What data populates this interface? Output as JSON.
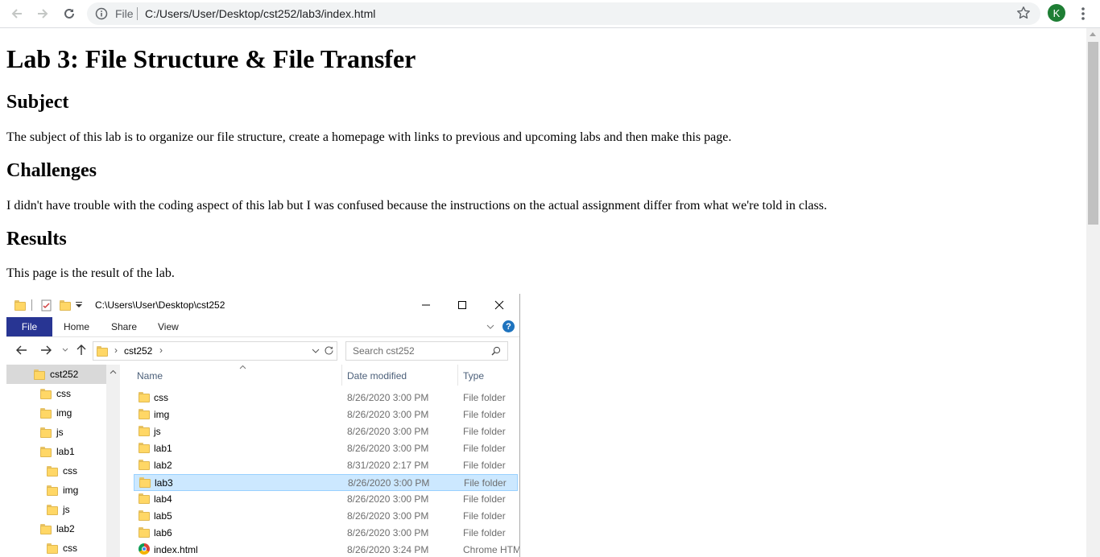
{
  "browser": {
    "scheme_label": "File",
    "url": "C:/Users/User/Desktop/cst252/lab3/index.html",
    "avatar_letter": "K",
    "avatar_color": "#1e7e34"
  },
  "page": {
    "title": "Lab 3: File Structure & File Transfer",
    "sections": [
      {
        "heading": "Subject",
        "text": "The subject of this lab is to organize our file structure, create a homepage with links to previous and upcoming labs and then make this page."
      },
      {
        "heading": "Challenges",
        "text": "I didn't have trouble with the coding aspect of this lab but I was confused because the instructions on the actual assignment differ from what we're told in class."
      },
      {
        "heading": "Results",
        "text": "This page is the result of the lab."
      }
    ]
  },
  "explorer": {
    "title_path": "C:\\Users\\User\\Desktop\\cst252",
    "ribbon": {
      "file": "File",
      "home": "Home",
      "share": "Share",
      "view": "View"
    },
    "address_crumb": "cst252",
    "search_placeholder": "Search cst252",
    "nav_tree": [
      {
        "label": "cst252",
        "level": 0,
        "selected": true
      },
      {
        "label": "css",
        "level": 1
      },
      {
        "label": "img",
        "level": 1
      },
      {
        "label": "js",
        "level": 1
      },
      {
        "label": "lab1",
        "level": 1
      },
      {
        "label": "css",
        "level": 2
      },
      {
        "label": "img",
        "level": 2
      },
      {
        "label": "js",
        "level": 2
      },
      {
        "label": "lab2",
        "level": 1
      },
      {
        "label": "css",
        "level": 2
      }
    ],
    "columns": {
      "name": "Name",
      "date": "Date modified",
      "type": "Type"
    },
    "files": [
      {
        "name": "css",
        "date": "8/26/2020 3:00 PM",
        "type": "File folder",
        "icon": "folder-icon"
      },
      {
        "name": "img",
        "date": "8/26/2020 3:00 PM",
        "type": "File folder",
        "icon": "folder-icon"
      },
      {
        "name": "js",
        "date": "8/26/2020 3:00 PM",
        "type": "File folder",
        "icon": "folder-icon"
      },
      {
        "name": "lab1",
        "date": "8/26/2020 3:00 PM",
        "type": "File folder",
        "icon": "folder-icon"
      },
      {
        "name": "lab2",
        "date": "8/31/2020 2:17 PM",
        "type": "File folder",
        "icon": "folder-icon"
      },
      {
        "name": "lab3",
        "date": "8/26/2020 3:00 PM",
        "type": "File folder",
        "icon": "folder-icon",
        "selected": true
      },
      {
        "name": "lab4",
        "date": "8/26/2020 3:00 PM",
        "type": "File folder",
        "icon": "folder-icon"
      },
      {
        "name": "lab5",
        "date": "8/26/2020 3:00 PM",
        "type": "File folder",
        "icon": "folder-icon"
      },
      {
        "name": "lab6",
        "date": "8/26/2020 3:00 PM",
        "type": "File folder",
        "icon": "folder-icon"
      },
      {
        "name": "index.html",
        "date": "8/26/2020 3:24 PM",
        "type": "Chrome HTML",
        "icon": "chrome-icon"
      }
    ]
  }
}
